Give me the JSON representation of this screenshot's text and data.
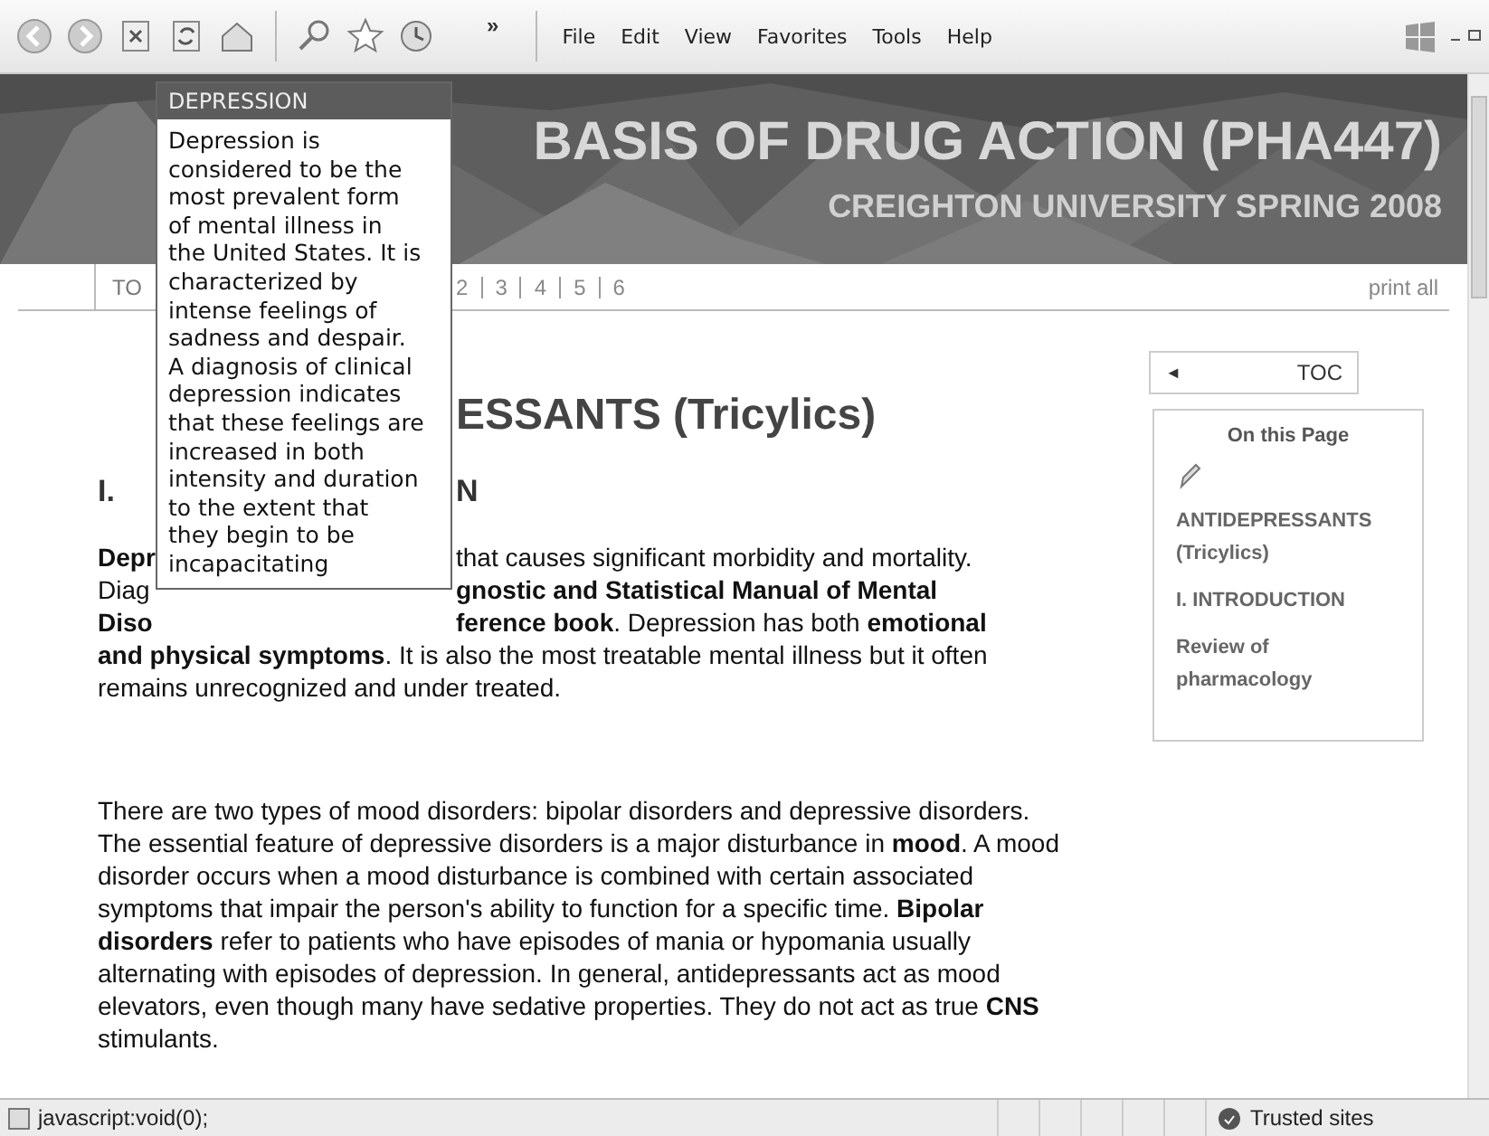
{
  "toolbar": {
    "chevron": "»",
    "menus": [
      "File",
      "Edit",
      "View",
      "Favorites",
      "Tools",
      "Help"
    ]
  },
  "banner": {
    "title": "BASIS OF DRUG ACTION (PHA447)",
    "subtitle": "CREIGHTON UNIVERSITY SPRING 2008"
  },
  "nav": {
    "left": "TO",
    "pages": [
      "2",
      "3",
      "4",
      "5",
      "6"
    ],
    "print": "print all"
  },
  "article": {
    "heading": "ESSANTS (Tricylics)",
    "section_number": "I.",
    "section_title": "N",
    "split_lines": [
      {
        "left": "**Depr**",
        "right": "that causes significant morbidity and mortality."
      },
      {
        "left": "Diag",
        "right": "**gnostic and Statistical Manual of Mental**"
      },
      {
        "left": "**Diso**",
        "right": "**ference book**. Depression has both **emotional**"
      }
    ],
    "paragraph_end": "**and physical symptoms**. It is also the most treatable mental illness but it often remains unrecognized and under treated.",
    "paragraph_2": "There are two types of mood disorders: bipolar disorders and depressive disorders.  The essential feature of depressive disorders is a major disturbance in **mood**.  A mood disorder occurs when a mood disturbance is combined with certain associated symptoms that impair the person's ability to function for a specific time. **Bipolar disorders** refer to patients who have episodes of mania or hypomania usually alternating with episodes of depression.  In general, antidepressants act as mood elevators, even though many have sedative properties.  They do not act as true **CNS** stimulants."
  },
  "toc_button": {
    "arrow": "◄",
    "label": "TOC"
  },
  "on_this_page": {
    "title": "On this Page",
    "links": [
      "ANTIDEPRESSANTS (Tricylics)",
      "I. INTRODUCTION",
      "Review of pharmacology"
    ]
  },
  "tooltip": {
    "title": "DEPRESSION",
    "text": "Depression is considered to be the most prevalent form of mental illness in the United States. It is characterized by intense feelings of sadness and despair. A diagnosis of clinical depression indicates that these feelings are increased in both intensity and duration to the extent that they begin to be incapacitating"
  },
  "status_bar": {
    "text": "javascript:void(0);",
    "zone": "Trusted sites"
  }
}
